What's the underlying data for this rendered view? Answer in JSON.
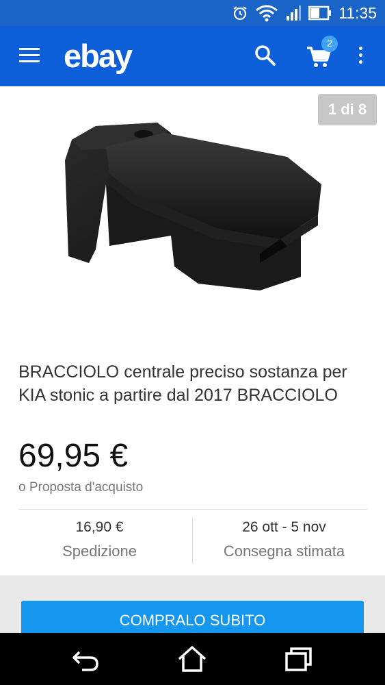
{
  "status_bar": {
    "time": "11:35"
  },
  "app_bar": {
    "logo": "ebay",
    "cart_count": "2"
  },
  "gallery": {
    "counter": "1 di 8"
  },
  "product": {
    "title": "BRACCIOLO centrale preciso sostanza per KIA stonic a partire dal 2017 BRACCIOLO",
    "price": "69,95 €",
    "offer": "o Proposta d'acquisto"
  },
  "shipping": {
    "cost_value": "16,90 €",
    "cost_label": "Spedizione",
    "delivery_value": "26 ott - 5 nov",
    "delivery_label": "Consegna stimata"
  },
  "actions": {
    "buy_now": "COMPRALO SUBITO"
  },
  "colors": {
    "primary": "#0d5fd9",
    "button": "#1596ef"
  }
}
